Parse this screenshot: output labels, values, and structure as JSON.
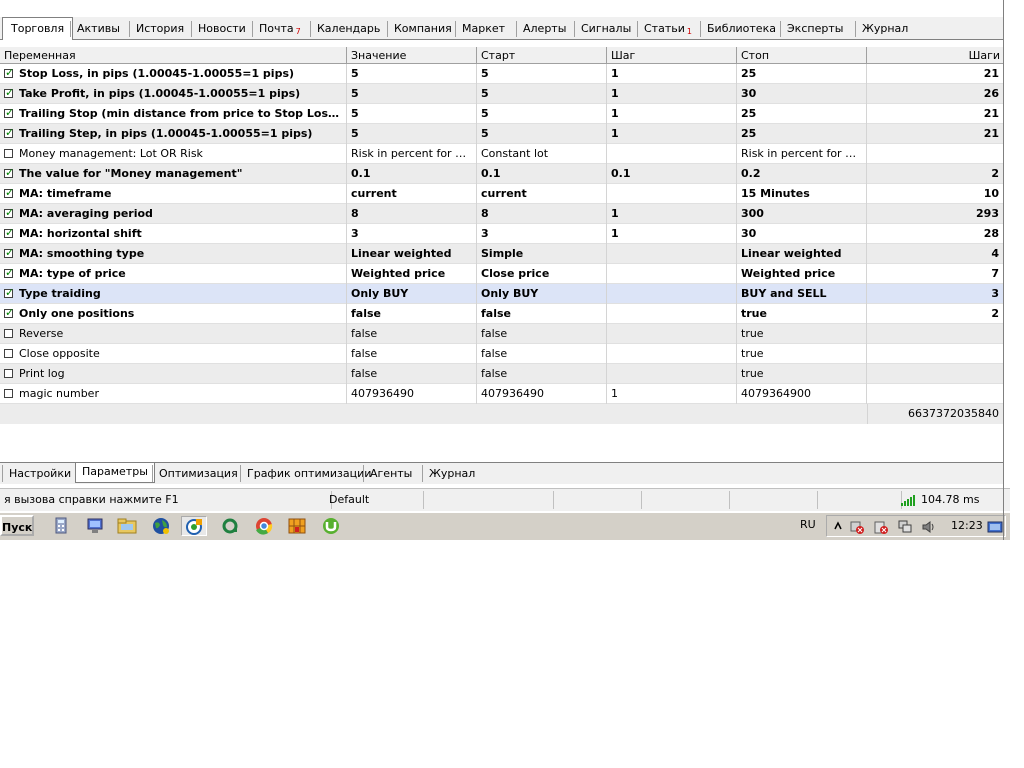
{
  "top_tabs": [
    {
      "label": "Торговля",
      "active": true
    },
    {
      "label": "Активы"
    },
    {
      "label": "История"
    },
    {
      "label": "Новости"
    },
    {
      "label": "Почта",
      "badge": "7"
    },
    {
      "label": "Календарь"
    },
    {
      "label": "Компания"
    },
    {
      "label": "Маркет"
    },
    {
      "label": "Алерты"
    },
    {
      "label": "Сигналы"
    },
    {
      "label": "Статьи",
      "badge": "1"
    },
    {
      "label": "Библиотека"
    },
    {
      "label": "Эксперты"
    },
    {
      "label": "Журнал"
    }
  ],
  "table": {
    "columns": [
      "Переменная",
      "Значение",
      "Старт",
      "Шаг",
      "Стоп",
      "Шаги"
    ],
    "rows": [
      {
        "checked": true,
        "bold": true,
        "alt": false,
        "sel": false,
        "name": "Stop Loss, in pips (1.00045-1.00055=1 pips)",
        "value": "5",
        "start": "5",
        "step": "1",
        "stop": "25",
        "steps": "21"
      },
      {
        "checked": true,
        "bold": true,
        "alt": true,
        "sel": false,
        "name": "Take Profit, in pips (1.00045-1.00055=1 pips)",
        "value": "5",
        "start": "5",
        "step": "1",
        "stop": "30",
        "steps": "26"
      },
      {
        "checked": true,
        "bold": true,
        "alt": false,
        "sel": false,
        "name": "Trailing Stop (min distance from price to Stop Loss, in pi...",
        "value": "5",
        "start": "5",
        "step": "1",
        "stop": "25",
        "steps": "21"
      },
      {
        "checked": true,
        "bold": true,
        "alt": true,
        "sel": false,
        "name": "Trailing Step, in pips (1.00045-1.00055=1 pips)",
        "value": "5",
        "start": "5",
        "step": "1",
        "stop": "25",
        "steps": "21"
      },
      {
        "checked": false,
        "bold": false,
        "alt": false,
        "sel": false,
        "name": "Money management: Lot OR Risk",
        "value": "Risk in percent for a deal",
        "start": "Constant lot",
        "step": "",
        "stop": "Risk in percent for a deal",
        "steps": ""
      },
      {
        "checked": true,
        "bold": true,
        "alt": true,
        "sel": false,
        "name": "The value for \"Money management\"",
        "value": "0.1",
        "start": "0.1",
        "step": "0.1",
        "stop": "0.2",
        "steps": "2"
      },
      {
        "checked": true,
        "bold": true,
        "alt": false,
        "sel": false,
        "name": "MA: timeframe",
        "value": "current",
        "start": "current",
        "step": "",
        "stop": "15 Minutes",
        "steps": "10"
      },
      {
        "checked": true,
        "bold": true,
        "alt": true,
        "sel": false,
        "name": "MA: averaging period",
        "value": "8",
        "start": "8",
        "step": "1",
        "stop": "300",
        "steps": "293"
      },
      {
        "checked": true,
        "bold": true,
        "alt": false,
        "sel": false,
        "name": "MA: horizontal shift",
        "value": "3",
        "start": "3",
        "step": "1",
        "stop": "30",
        "steps": "28"
      },
      {
        "checked": true,
        "bold": true,
        "alt": true,
        "sel": false,
        "name": "MA: smoothing type",
        "value": "Linear weighted",
        "start": "Simple",
        "step": "",
        "stop": "Linear weighted",
        "steps": "4"
      },
      {
        "checked": true,
        "bold": true,
        "alt": false,
        "sel": false,
        "name": "MA: type of price",
        "value": "Weighted price",
        "start": "Close price",
        "step": "",
        "stop": "Weighted price",
        "steps": "7"
      },
      {
        "checked": true,
        "bold": true,
        "alt": false,
        "sel": true,
        "name": "Type traiding",
        "value": "Only BUY",
        "start": "Only BUY",
        "step": "",
        "stop": "BUY and SELL",
        "steps": "3"
      },
      {
        "checked": true,
        "bold": true,
        "alt": false,
        "sel": false,
        "name": "Only one positions",
        "value": "false",
        "start": "false",
        "step": "",
        "stop": "true",
        "steps": "2"
      },
      {
        "checked": false,
        "bold": false,
        "alt": true,
        "sel": false,
        "name": "Reverse",
        "value": "false",
        "start": "false",
        "step": "",
        "stop": "true",
        "steps": ""
      },
      {
        "checked": false,
        "bold": false,
        "alt": false,
        "sel": false,
        "name": "Close opposite",
        "value": "false",
        "start": "false",
        "step": "",
        "stop": "true",
        "steps": ""
      },
      {
        "checked": false,
        "bold": false,
        "alt": true,
        "sel": false,
        "name": "Print log",
        "value": "false",
        "start": "false",
        "step": "",
        "stop": "true",
        "steps": ""
      },
      {
        "checked": false,
        "bold": false,
        "alt": false,
        "sel": false,
        "name": "magic number",
        "value": "407936490",
        "start": "407936490",
        "step": "1",
        "stop": "4079364900",
        "steps": ""
      }
    ],
    "total": "6637372035840"
  },
  "bottom_tabs": [
    {
      "label": "Настройки"
    },
    {
      "label": "Параметры",
      "active": true
    },
    {
      "label": "Оптимизация"
    },
    {
      "label": "График оптимизации"
    },
    {
      "label": "Агенты"
    },
    {
      "label": "Журнал"
    }
  ],
  "status": {
    "help": "я вызова справки нажмите F1",
    "profile": "Default",
    "ping": "104.78 ms"
  },
  "taskbar": {
    "start_label": "Пуск",
    "icons": [
      "calculator-icon",
      "monitor-icon",
      "folder-icon",
      "globe-icon",
      "metatrader-icon",
      "green-circle-icon",
      "chrome-icon",
      "grid-app-icon",
      "utorrent-icon"
    ],
    "lang": "RU",
    "clock": "12:23"
  }
}
